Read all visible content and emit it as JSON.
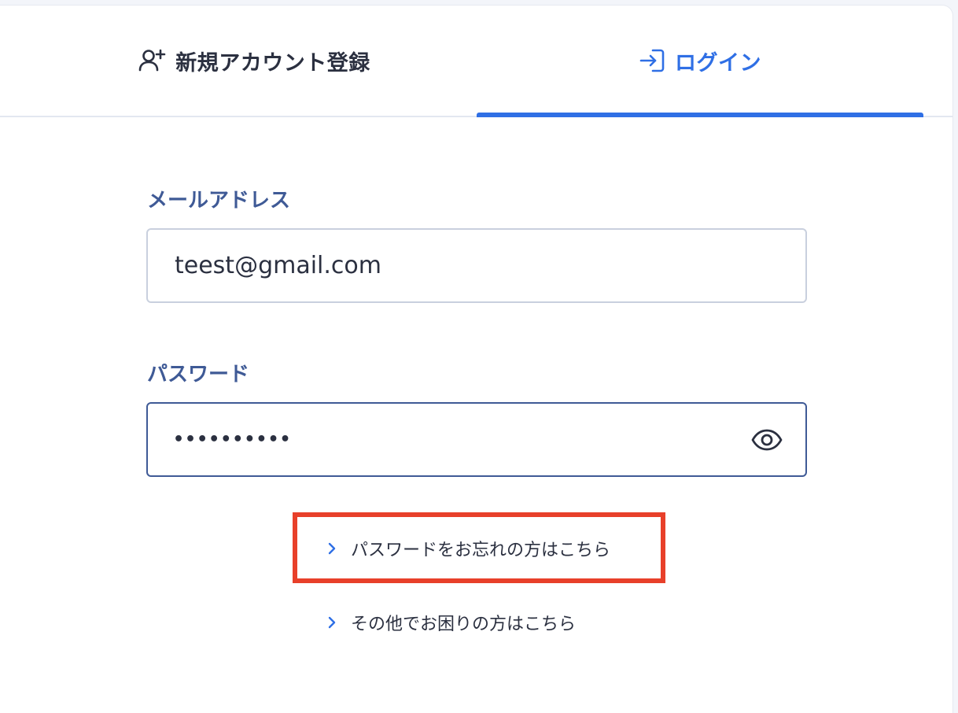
{
  "tabs": {
    "register": {
      "label": "新規アカウント登録",
      "icon": "user-plus-icon"
    },
    "login": {
      "label": "ログイン",
      "icon": "login-arrow-icon",
      "active": true
    }
  },
  "form": {
    "email": {
      "label": "メールアドレス",
      "value": "teest@gmail.com"
    },
    "password": {
      "label": "パスワード",
      "value": "••••••••••",
      "toggle_icon": "eye-icon"
    }
  },
  "links": {
    "forgot_password": "パスワードをお忘れの方はこちら",
    "other_help": "その他でお困りの方はこちら"
  },
  "colors": {
    "accent": "#2f6fe5",
    "label": "#3f5a96",
    "highlight": "#e8402a"
  }
}
